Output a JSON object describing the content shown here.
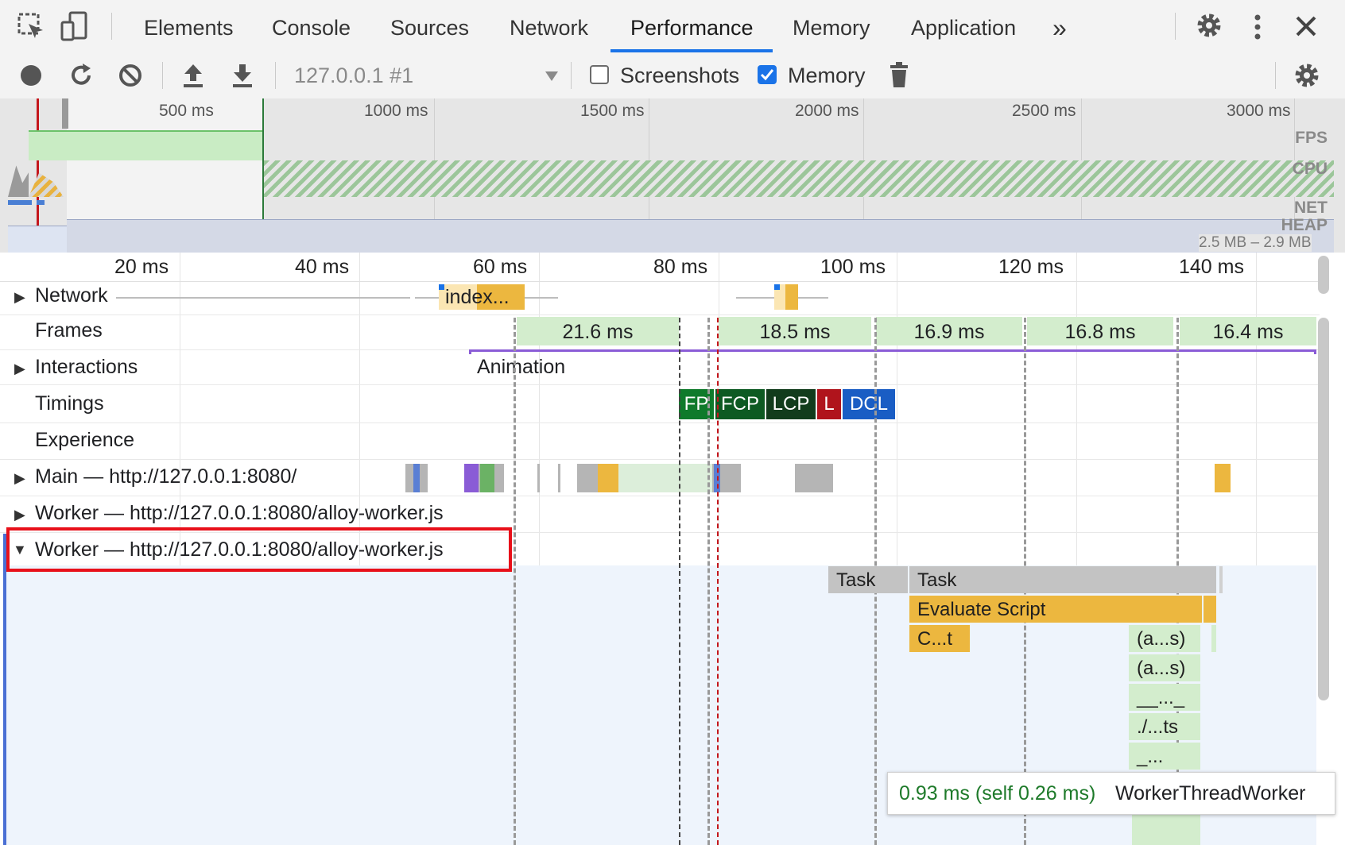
{
  "tabs": [
    "Elements",
    "Console",
    "Sources",
    "Network",
    "Performance",
    "Memory",
    "Application"
  ],
  "more_tabs": "»",
  "toolbar": {
    "profile_select": "127.0.0.1 #1",
    "screenshots_label": "Screenshots",
    "screenshots_checked": false,
    "memory_label": "Memory",
    "memory_checked": true
  },
  "overview": {
    "ticks": [
      "500 ms",
      "1000 ms",
      "1500 ms",
      "2000 ms",
      "2500 ms",
      "3000 ms"
    ],
    "labels": {
      "fps": "FPS",
      "cpu": "CPU",
      "net": "NET",
      "heap": "HEAP"
    },
    "heap_range": "2.5 MB – 2.9 MB"
  },
  "ruler": [
    "20 ms",
    "40 ms",
    "60 ms",
    "80 ms",
    "100 ms",
    "120 ms",
    "140 ms"
  ],
  "tracks": {
    "network": "Network",
    "network_item": "index...",
    "frames": "Frames",
    "frame_durations": [
      "21.6 ms",
      "18.5 ms",
      "16.9 ms",
      "16.8 ms",
      "16.4 ms"
    ],
    "interactions": "Interactions",
    "interaction_item": "Animation",
    "timings": "Timings",
    "timing_markers": [
      "FP",
      "FCP",
      "LCP",
      "L",
      "DCL"
    ],
    "experience": "Experience",
    "main": "Main — http://127.0.0.1:8080/",
    "worker1": "Worker — http://127.0.0.1:8080/alloy-worker.js",
    "worker2": "Worker — http://127.0.0.1:8080/alloy-worker.js"
  },
  "flame": {
    "task1": "Task",
    "task2": "Task",
    "evaluate": "Evaluate Script",
    "compile": "C...t",
    "calls": [
      "(a...s)",
      "(a...s)",
      "__..._",
      "./...ts",
      "_..."
    ]
  },
  "tooltip": {
    "time": "0.93 ms (self 0.26 ms)",
    "name": "WorkerThreadWorker"
  },
  "colors": {
    "accent": "#1a73e8",
    "highlight_box": "#e8101a",
    "script_yellow": "#ecb73f",
    "task_gray": "#c3c3c3",
    "frame_green": "#d3edcd",
    "fp_green": "#0f7a2b",
    "fcp_green": "#0d5a22",
    "lcp_dark": "#123c1c",
    "load_red": "#b0141c",
    "dcl_blue": "#1a5dc4"
  }
}
